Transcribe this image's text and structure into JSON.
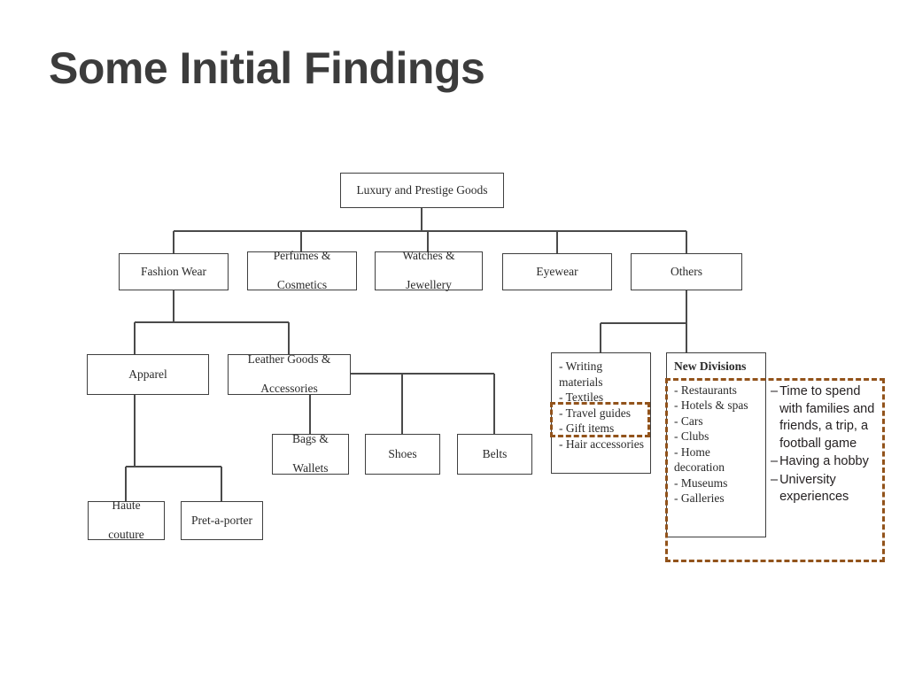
{
  "slide": {
    "title": "Some Initial Findings",
    "background_color": "#ffffff",
    "title_color": "#3c3c3c",
    "highlight_color": "#92531b",
    "node_border_color": "#3f3f3f"
  },
  "diagram": {
    "type": "org-chart",
    "root": {
      "label": "Luxury and Prestige Goods"
    },
    "level2": [
      {
        "label": "Fashion Wear"
      },
      {
        "label": "Perfumes & Cosmetics",
        "line1": "Perfumes &",
        "line2": "Cosmetics"
      },
      {
        "label": "Watches & Jewellery",
        "line1": "Watches &",
        "line2": "Jewellery"
      },
      {
        "label": "Eyewear"
      },
      {
        "label": "Others"
      }
    ],
    "level3": [
      {
        "label": "Apparel"
      },
      {
        "label": "Leather Goods & Accessories",
        "line1": "Leather Goods &",
        "line2": "Accessories"
      }
    ],
    "level4": [
      {
        "label": "Bags & Wallets",
        "line1": "Bags &",
        "line2": "Wallets"
      },
      {
        "label": "Shoes"
      },
      {
        "label": "Belts"
      }
    ],
    "level5": [
      {
        "label": "Haute couture",
        "line1": "Haute",
        "line2": "couture"
      },
      {
        "label": "Pret-a-porter"
      }
    ]
  },
  "others_list": {
    "items": [
      "- Writing materials",
      "- Textiles",
      "- Travel guides",
      "- Gift items",
      "- Hair accessories"
    ]
  },
  "new_divisions": {
    "title": "New Divisions",
    "items": [
      "- Restaurants",
      "- Hotels & spas",
      "- Cars",
      "- Clubs",
      "- Home decoration",
      "- Museums",
      "- Galleries"
    ]
  },
  "bullets": {
    "marker": "–",
    "items": [
      "Time to spend with families and friends, a trip, a football game",
      "Having a hobby",
      "University experiences"
    ]
  }
}
